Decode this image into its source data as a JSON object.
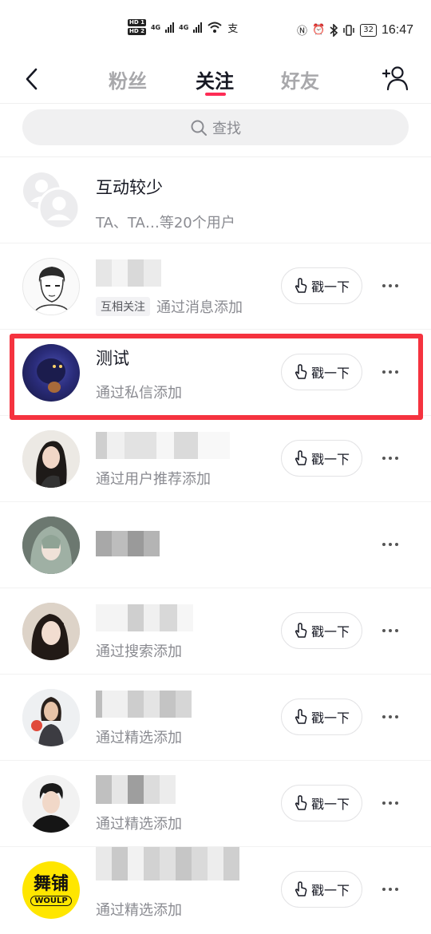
{
  "status_bar": {
    "hd1": "HD 1",
    "hd2": "HD 2",
    "net1": "4G",
    "net2": "4G",
    "battery": "32",
    "time": "16:47"
  },
  "header": {
    "tabs": [
      {
        "label": "粉丝",
        "active": false
      },
      {
        "label": "关注",
        "active": true
      },
      {
        "label": "好友",
        "active": false
      }
    ]
  },
  "search": {
    "placeholder": "查找"
  },
  "list": {
    "group": {
      "title": "互动较少",
      "subtitle": "TA、TA…等20个用户"
    },
    "items": [
      {
        "name": "",
        "tag": "互相关注",
        "source": "通过消息添加",
        "poke": "戳一下",
        "has_poke": true
      },
      {
        "name": "测试",
        "source": "通过私信添加",
        "poke": "戳一下",
        "has_poke": true,
        "highlighted": true
      },
      {
        "name": "",
        "source": "通过用户推荐添加",
        "poke": "戳一下",
        "has_poke": true
      },
      {
        "name": "",
        "source": "",
        "has_poke": false
      },
      {
        "name": "",
        "source": "通过搜索添加",
        "poke": "戳一下",
        "has_poke": true
      },
      {
        "name": "",
        "source": "通过精选添加",
        "poke": "戳一下",
        "has_poke": true
      },
      {
        "name": "",
        "source": "通过精选添加",
        "poke": "戳一下",
        "has_poke": true
      },
      {
        "name": "",
        "source": "通过精选添加",
        "poke": "戳一下",
        "has_poke": true
      }
    ],
    "logo_text": "舞铺",
    "logo_sub": "WOULP"
  },
  "colors": {
    "accent": "#fe2c55",
    "highlight_border": "#f5333f",
    "muted_text": "#8a8b91"
  }
}
